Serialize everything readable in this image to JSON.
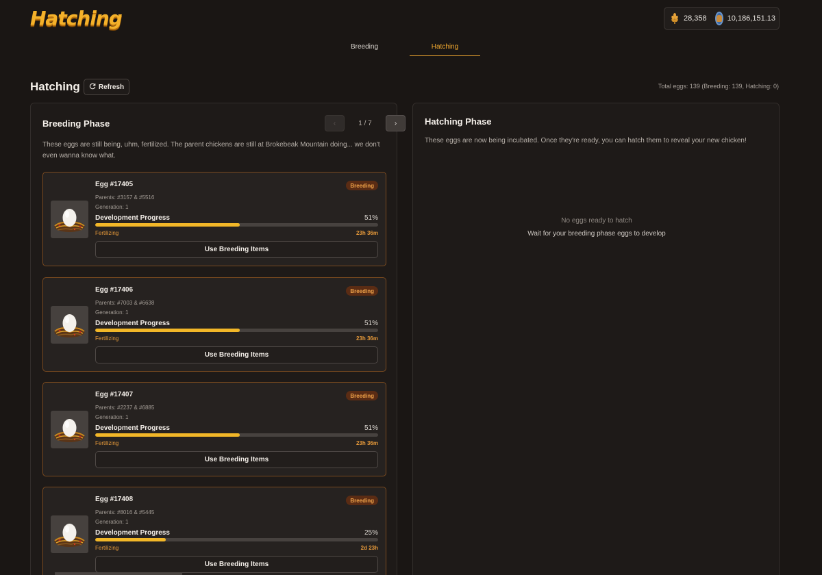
{
  "app": {
    "logo_text": "Hatching"
  },
  "balances": {
    "feed": {
      "icon": "wheat-icon",
      "value": "28,358"
    },
    "coins": {
      "icon": "coin-avatar-icon",
      "value": "10,186,151.13"
    }
  },
  "tabs": [
    {
      "label": "Breeding",
      "active": false
    },
    {
      "label": "Hatching",
      "active": true
    }
  ],
  "header": {
    "title": "Hatching",
    "refresh_label": "Refresh",
    "total_eggs": "Total eggs: 139 (Breeding: 139, Hatching: 0)"
  },
  "breeding_panel": {
    "title": "Breeding Phase",
    "description": "These eggs are still being, uhm, fertilized. The parent chickens are still at Brokebeak Mountain doing... we don't even wanna know what.",
    "pager": {
      "prev": "‹",
      "text": "1 / 7",
      "next": "›"
    },
    "eggs": [
      {
        "name": "Egg #17405",
        "badge": "Breeding",
        "parents": "Parents: #3157 & #5516",
        "generation": "Generation: 1",
        "progress_label": "Development Progress",
        "progress_pct": "51%",
        "progress": 0.51,
        "status": "Fertilizing",
        "time": "23h 36m",
        "action": "Use Breeding Items"
      },
      {
        "name": "Egg #17406",
        "badge": "Breeding",
        "parents": "Parents: #7003 & #6638",
        "generation": "Generation: 1",
        "progress_label": "Development Progress",
        "progress_pct": "51%",
        "progress": 0.51,
        "status": "Fertilizing",
        "time": "23h 36m",
        "action": "Use Breeding Items"
      },
      {
        "name": "Egg #17407",
        "badge": "Breeding",
        "parents": "Parents: #2237 & #6885",
        "generation": "Generation: 1",
        "progress_label": "Development Progress",
        "progress_pct": "51%",
        "progress": 0.51,
        "status": "Fertilizing",
        "time": "23h 36m",
        "action": "Use Breeding Items"
      },
      {
        "name": "Egg #17408",
        "badge": "Breeding",
        "parents": "Parents: #8016 & #5445",
        "generation": "Generation: 1",
        "progress_label": "Development Progress",
        "progress_pct": "25%",
        "progress": 0.25,
        "status": "Fertilizing",
        "time": "2d 23h",
        "action": "Use Breeding Items"
      }
    ]
  },
  "hatching_panel": {
    "title": "Hatching Phase",
    "description": "These eggs are now being incubated. Once they're ready, you can hatch them to reveal your new chicken!",
    "empty_title": "No eggs ready to hatch",
    "empty_subtitle": "Wait for your breeding phase eggs to develop"
  },
  "colors": {
    "accent": "#f0a830",
    "progress": "#f2b728",
    "card_border": "#7a4a1f",
    "badge_bg": "#5a2c14"
  }
}
